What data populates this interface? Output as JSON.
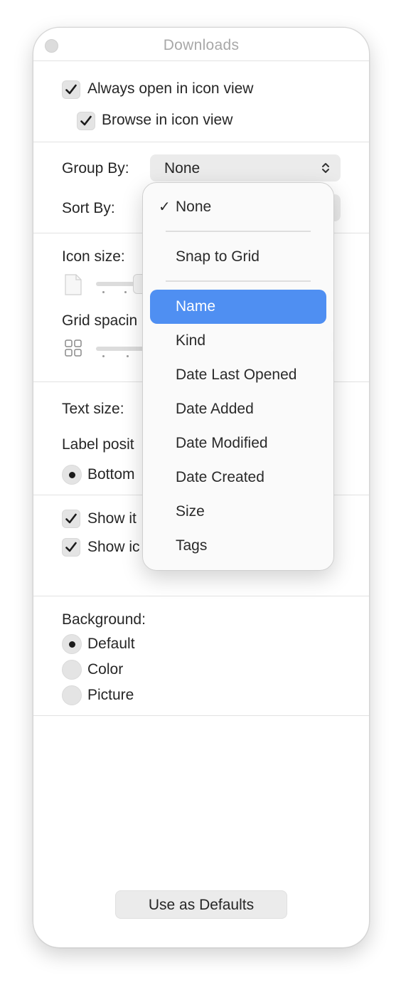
{
  "window": {
    "title": "Downloads"
  },
  "options": {
    "always_open_icon_view": {
      "label": "Always open in icon view",
      "checked": true
    },
    "browse_icon_view": {
      "label": "Browse in icon view",
      "checked": true
    }
  },
  "group_by": {
    "label": "Group By:",
    "value": "None"
  },
  "sort_by": {
    "label": "Sort By:"
  },
  "icon_size": {
    "label": "Icon size:"
  },
  "grid_spacing": {
    "label": "Grid spacin"
  },
  "text_size": {
    "label": "Text size:"
  },
  "label_position": {
    "label": "Label posit",
    "options": [
      {
        "label": "Bottom",
        "selected": true
      }
    ]
  },
  "show": {
    "item_info": {
      "label": "Show it",
      "checked": true
    },
    "icon_preview": {
      "label": "Show ic",
      "checked": true
    }
  },
  "background": {
    "label": "Background:",
    "options": [
      {
        "label": "Default",
        "selected": true
      },
      {
        "label": "Color",
        "selected": false
      },
      {
        "label": "Picture",
        "selected": false
      }
    ]
  },
  "defaults_button": {
    "label": "Use as Defaults"
  },
  "menu": {
    "check_glyph": "✓",
    "items": [
      {
        "label": "None",
        "checked": true
      },
      {
        "label": "Snap to Grid"
      },
      {
        "label": "Name",
        "selected": true
      },
      {
        "label": "Kind"
      },
      {
        "label": "Date Last Opened"
      },
      {
        "label": "Date Added"
      },
      {
        "label": "Date Modified"
      },
      {
        "label": "Date Created"
      },
      {
        "label": "Size"
      },
      {
        "label": "Tags"
      }
    ]
  },
  "colors": {
    "accent": "#4f8ff2",
    "separator": "#e2e2e2",
    "control": "#ebebeb"
  }
}
